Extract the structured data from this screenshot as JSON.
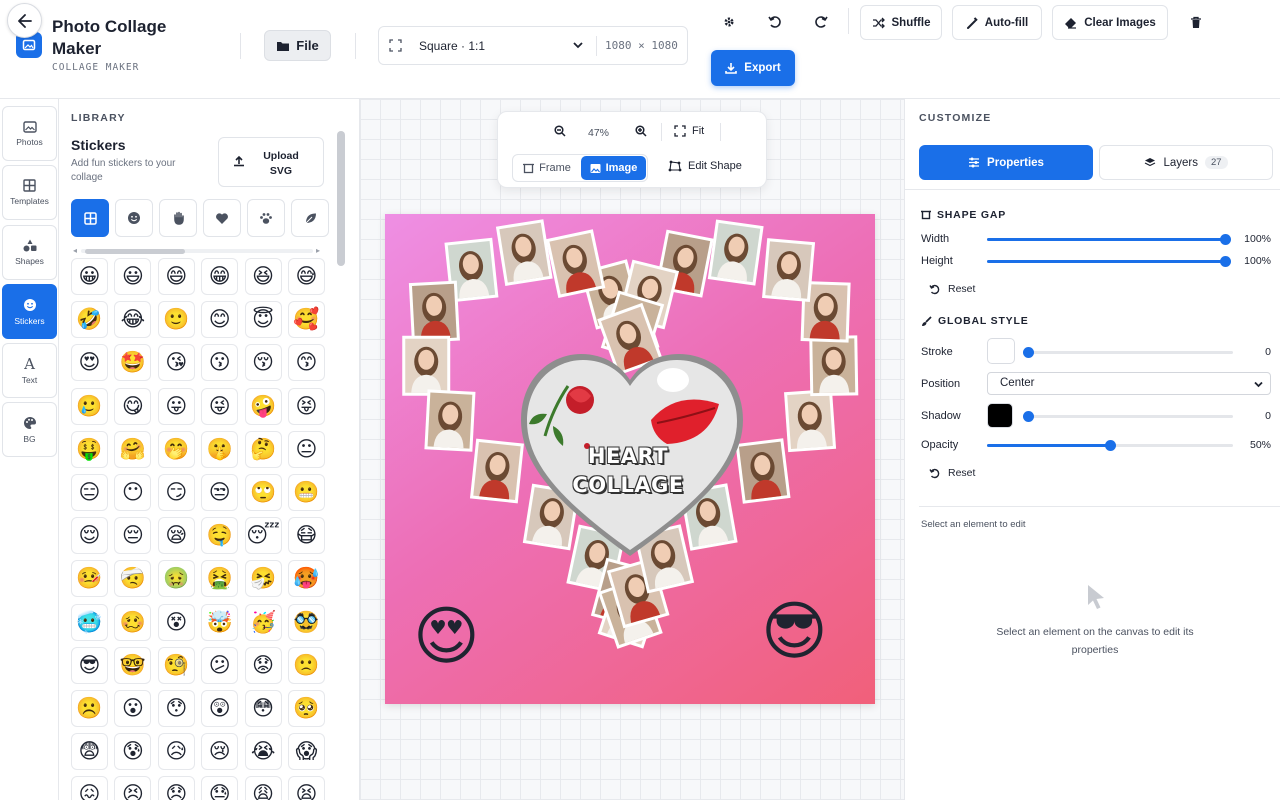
{
  "app": {
    "title": "Photo Collage Maker",
    "subtitle": "COLLAGE MAKER",
    "back_icon": "arrow-left-icon",
    "logo_icon": "photo-icon"
  },
  "header": {
    "file_label": "File",
    "canvas_preset": "Square · 1:1",
    "canvas_dims": "1080 × 1080",
    "settings_icon": "gear-icon",
    "undo_icon": "undo-icon",
    "redo_icon": "redo-icon",
    "shuffle_label": "Shuffle",
    "autofill_label": "Auto-fill",
    "clear_label": "Clear Images",
    "delete_icon": "trash-icon",
    "export_label": "Export"
  },
  "rail": {
    "items": [
      {
        "label": "Photos",
        "icon": "photos-icon",
        "active": false
      },
      {
        "label": "Templates",
        "icon": "grid-icon",
        "active": false
      },
      {
        "label": "Shapes",
        "icon": "shapes-icon",
        "active": false
      },
      {
        "label": "Stickers",
        "icon": "smiley-icon",
        "active": true
      },
      {
        "label": "Text",
        "icon": "text-icon",
        "active": false
      },
      {
        "label": "BG",
        "icon": "palette-icon",
        "active": false
      }
    ]
  },
  "library": {
    "heading": "LIBRARY",
    "section_title": "Stickers",
    "section_desc": "Add fun stickers to your collage",
    "upload_label": "Upload SVG",
    "categories": [
      "all-grid-icon",
      "smiley-icon",
      "hand-icon",
      "heart-icon",
      "paw-icon",
      "leaf-icon"
    ],
    "emojis": [
      "😀",
      "😃",
      "😄",
      "😁",
      "😆",
      "😅",
      "🤣",
      "😂",
      "🙂",
      "😊",
      "😇",
      "🥰",
      "😍",
      "🤩",
      "😘",
      "😗",
      "😚",
      "😙",
      "🥲",
      "😋",
      "😛",
      "😜",
      "🤪",
      "😝",
      "🤑",
      "🤗",
      "🤭",
      "🤫",
      "🤔",
      "😐",
      "😑",
      "😶",
      "😏",
      "😒",
      "🙄",
      "😬",
      "😌",
      "😔",
      "😪",
      "🤤",
      "😴",
      "😷",
      "🤒",
      "🤕",
      "🤢",
      "🤮",
      "🤧",
      "🥵",
      "🥶",
      "🥴",
      "😵",
      "🤯",
      "🥳",
      "🥸",
      "😎",
      "🤓",
      "🧐",
      "😕",
      "😟",
      "🙁",
      "☹️",
      "😮",
      "😯",
      "😲",
      "😳",
      "🥺",
      "😨",
      "😰",
      "😥",
      "😢",
      "😭",
      "😱",
      "😖",
      "😣",
      "😞",
      "😓",
      "😩",
      "😫"
    ]
  },
  "canvas_toolbar": {
    "zoom_out_icon": "zoom-out-icon",
    "zoom": "47%",
    "zoom_in_icon": "zoom-in-icon",
    "fit_label": "Fit",
    "frame_label": "Frame",
    "image_label": "Image",
    "edit_shape_label": "Edit Shape"
  },
  "collage": {
    "center_line1": "HEART",
    "center_line2": "COLLAGE",
    "left_emoji": "😍",
    "right_emoji": "😎",
    "photo_count": 27,
    "bg_colors": [
      "#ee8fe4",
      "#ed6fb6",
      "#f1607a"
    ]
  },
  "customize": {
    "heading": "CUSTOMIZE",
    "tab_properties": "Properties",
    "tab_layers": "Layers",
    "layers_count": "27",
    "shape_gap_title": "SHAPE GAP",
    "width_label": "Width",
    "width_value": "100%",
    "width_level": 1.0,
    "height_label": "Height",
    "height_value": "100%",
    "height_level": 1.0,
    "reset_label": "Reset",
    "global_style_title": "GLOBAL STYLE",
    "stroke_label": "Stroke",
    "stroke_value": "0",
    "stroke_level": 0.0,
    "stroke_color": "#ffffff",
    "position_label": "Position",
    "position_value": "Center",
    "shadow_label": "Shadow",
    "shadow_value": "0",
    "shadow_level": 0.0,
    "shadow_color": "#000000",
    "opacity_label": "Opacity",
    "opacity_value": "50%",
    "opacity_level": 0.5,
    "hint_small": "Select an element to edit",
    "hint_center": "Select an element on the canvas to edit its properties"
  },
  "theme": {
    "accent": "#1a6fe8"
  }
}
